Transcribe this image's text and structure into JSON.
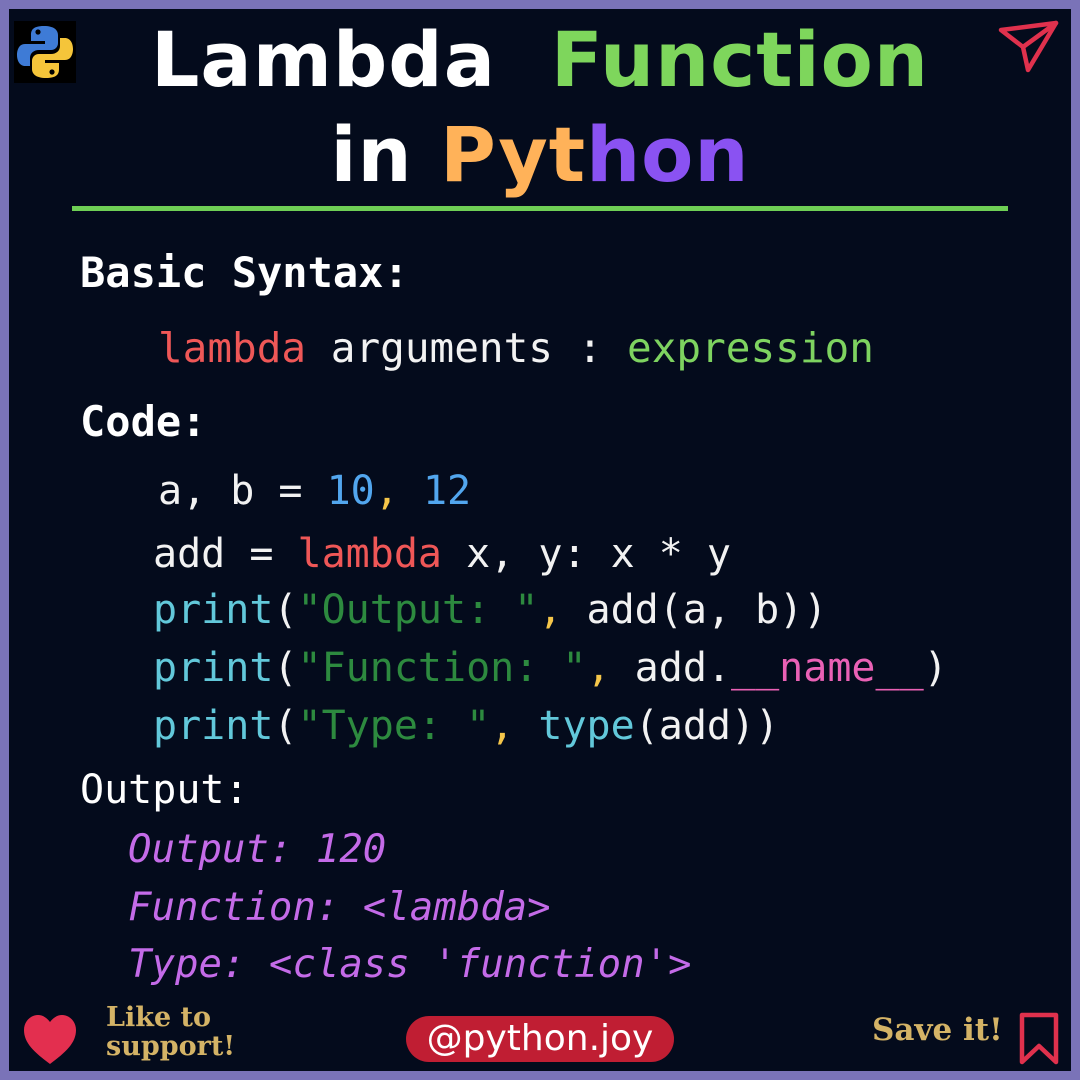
{
  "header": {
    "title_line1": [
      {
        "text": "Lambda",
        "color": "#ffffff"
      },
      {
        "text": "Function",
        "color": "#7ed65c"
      }
    ],
    "title_line2": [
      {
        "text": "in",
        "color": "#ffffff"
      },
      {
        "text": "Pyt",
        "color": "#ffb259"
      },
      {
        "text": "hon",
        "color": "#8a52f2"
      }
    ],
    "logo_icon": "python-logo-icon",
    "share_icon": "send-icon",
    "divider_color": "#6fcf55"
  },
  "syntax": {
    "heading": "Basic Syntax:",
    "keyword": "lambda",
    "arguments": "arguments",
    "colon": ":",
    "expression": "expression"
  },
  "code": {
    "heading": "Code:",
    "line1": {
      "vars": "a, b = ",
      "num1": "10",
      "comma": ",",
      "num2": "12"
    },
    "line2": {
      "lhs": "add = ",
      "keyword": "lambda",
      "rest": " x, y: x * y"
    },
    "line3": {
      "fn": "print",
      "open": "(",
      "str": "\"Output: \"",
      "comma": ",",
      "rest": " add(a, b))"
    },
    "line4": {
      "fn": "print",
      "open": "(",
      "str": "\"Function: \"",
      "comma": ",",
      "obj": " add.",
      "dunder": "__name__",
      "close": ")"
    },
    "line5": {
      "fn": "print",
      "open": "(",
      "str": "\"Type: \"",
      "comma": ",",
      "sp": " ",
      "fn2": "type",
      "rest": "(add))"
    }
  },
  "output": {
    "heading": "Output:",
    "lines": [
      "Output: 120",
      "Function: <lambda>",
      "Type: <class 'function'>"
    ]
  },
  "footer": {
    "like_line1": "Like to",
    "like_line2": "support!",
    "handle": "@python.joy",
    "save": "Save it!",
    "heart_icon": "heart-icon",
    "bookmark_icon": "bookmark-icon",
    "accent": "#c01e33"
  }
}
